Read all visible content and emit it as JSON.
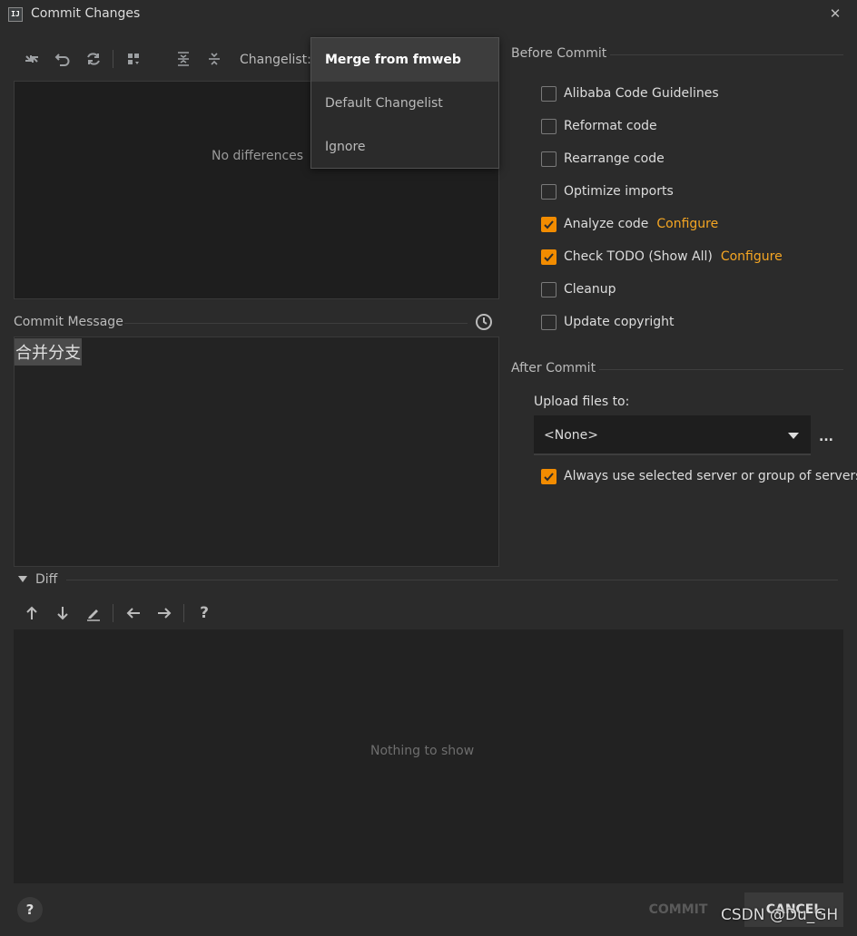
{
  "window": {
    "title": "Commit Changes",
    "logo_text": "IJ"
  },
  "toolbar": {
    "changelist_label": "Changelist:"
  },
  "changelist_dropdown": {
    "items": [
      "Merge from fmweb",
      "Default Changelist",
      "Ignore"
    ],
    "selected": "Merge from fmweb"
  },
  "changes": {
    "empty_text": "No differences"
  },
  "commit_message": {
    "label": "Commit Message",
    "value": "合并分支"
  },
  "before_commit": {
    "title": "Before Commit",
    "options": [
      {
        "label": "Alibaba Code Guidelines",
        "checked": false
      },
      {
        "label": "Reformat code",
        "checked": false
      },
      {
        "label": "Rearrange code",
        "checked": false
      },
      {
        "label": "Optimize imports",
        "checked": false
      },
      {
        "label": "Analyze code",
        "checked": true,
        "link": "Configure"
      },
      {
        "label": "Check TODO (Show All)",
        "checked": true,
        "link": "Configure"
      },
      {
        "label": "Cleanup",
        "checked": false
      },
      {
        "label": "Update copyright",
        "checked": false
      }
    ]
  },
  "after_commit": {
    "title": "After Commit",
    "upload_label": "Upload files to:",
    "upload_value": "<None>",
    "more_label": "...",
    "always_use_label": "Always use selected server or group of servers",
    "always_use_checked": true
  },
  "diff": {
    "label": "Diff",
    "empty_text": "Nothing to show"
  },
  "footer": {
    "help_label": "?",
    "commit_label": "COMMIT",
    "cancel_label": "CANCEL"
  },
  "watermark": "CSDN @Du_GH",
  "colors": {
    "background": "#2b2b2b",
    "accent": "#f28c00",
    "link": "#f5a623"
  }
}
